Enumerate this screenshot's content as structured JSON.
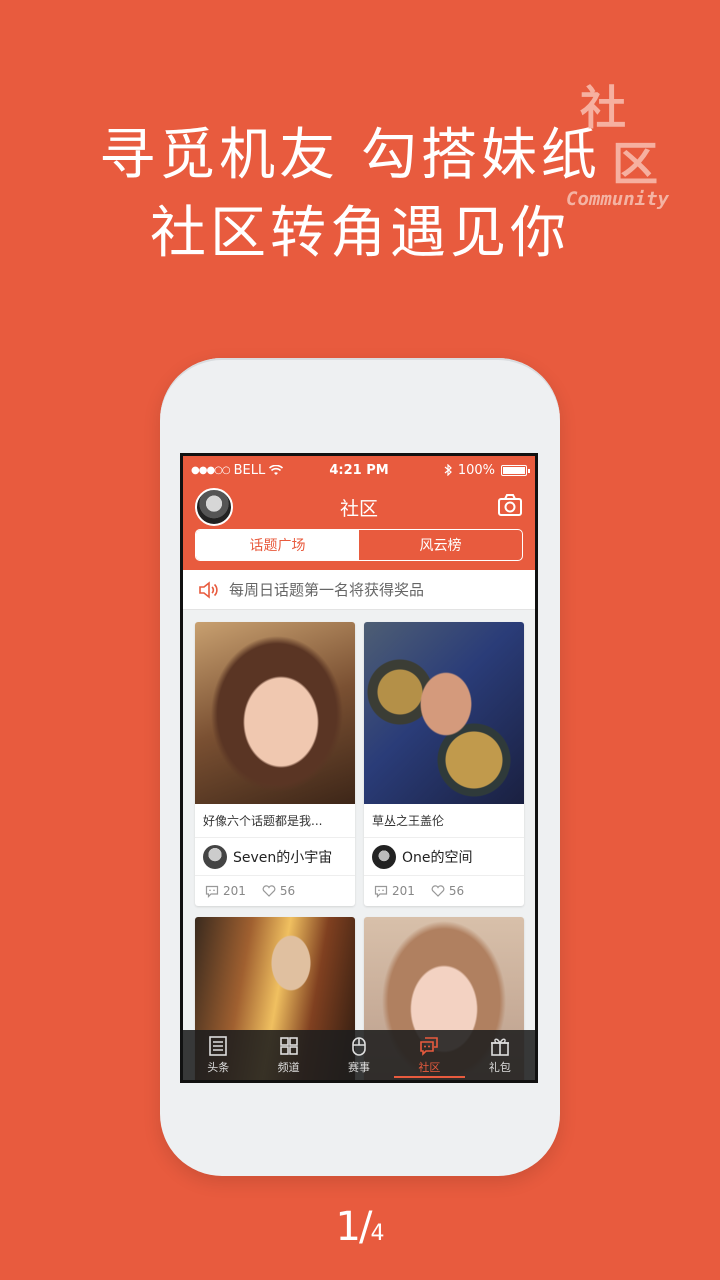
{
  "headline": {
    "line1": "寻觅机友 勾搭妹纸",
    "line2": "社区转角遇见你"
  },
  "stamp": {
    "char1": "社",
    "char2": "区",
    "en": "Community"
  },
  "statusbar": {
    "carrier": "BELL",
    "time": "4:21 PM",
    "battery": "100%"
  },
  "navbar": {
    "title": "社区",
    "segments": [
      "话题广场",
      "风云榜"
    ]
  },
  "notice": {
    "text": "每周日话题第一名将获得奖品"
  },
  "cards": [
    {
      "caption": "好像六个话题都是我...",
      "user": "Seven的小宇宙",
      "comments": "201",
      "likes": "56"
    },
    {
      "caption": "草丛之王盖伦",
      "user": "One的空间",
      "comments": "201",
      "likes": "56"
    }
  ],
  "tabbar": {
    "tabs": [
      "头条",
      "频道",
      "赛事",
      "社区",
      "礼包"
    ],
    "active": "社区"
  },
  "pager": {
    "current": "1",
    "separator": "/",
    "total": "4"
  },
  "colors": {
    "accent": "#e85b3e"
  }
}
